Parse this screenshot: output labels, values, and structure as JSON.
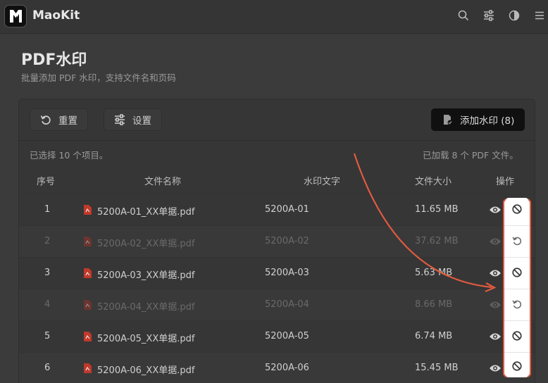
{
  "app": {
    "name": "MaoKit"
  },
  "topbar_icons": [
    "search-icon",
    "sliders-icon",
    "contrast-icon",
    "menu-icon"
  ],
  "page": {
    "title": "PDF水印",
    "subtitle": "批量添加 PDF 水印，支持文件名和页码"
  },
  "toolbar": {
    "reset_label": "重置",
    "settings_label": "设置",
    "add_label": "添加水印 (8)"
  },
  "status": {
    "selected": "已选择 10 个项目。",
    "loaded": "已加载 8 个 PDF 文件。"
  },
  "table": {
    "headers": {
      "index": "序号",
      "filename": "文件名称",
      "watermark": "水印文字",
      "size": "文件大小",
      "actions": "操作"
    },
    "rows": [
      {
        "index": "1",
        "filename": "5200A-01_XX单据.pdf",
        "watermark": "5200A-01",
        "size": "11.65 MB",
        "disabled": false,
        "action": "disable"
      },
      {
        "index": "2",
        "filename": "5200A-02_XX单据.pdf",
        "watermark": "5200A-02",
        "size": "37.62 MB",
        "disabled": true,
        "action": "restore"
      },
      {
        "index": "3",
        "filename": "5200A-03_XX单据.pdf",
        "watermark": "5200A-03",
        "size": "5.63 MB",
        "disabled": false,
        "action": "disable"
      },
      {
        "index": "4",
        "filename": "5200A-04_XX单据.pdf",
        "watermark": "5200A-04",
        "size": "8.66 MB",
        "disabled": true,
        "action": "restore"
      },
      {
        "index": "5",
        "filename": "5200A-05_XX单据.pdf",
        "watermark": "5200A-05",
        "size": "6.74 MB",
        "disabled": false,
        "action": "disable"
      },
      {
        "index": "6",
        "filename": "5200A-06_XX单据.pdf",
        "watermark": "5200A-06",
        "size": "15.45 MB",
        "disabled": false,
        "action": "disable"
      }
    ]
  },
  "colors": {
    "accent_annotation": "#e05a3f",
    "pdf_icon": "#c0392b"
  }
}
